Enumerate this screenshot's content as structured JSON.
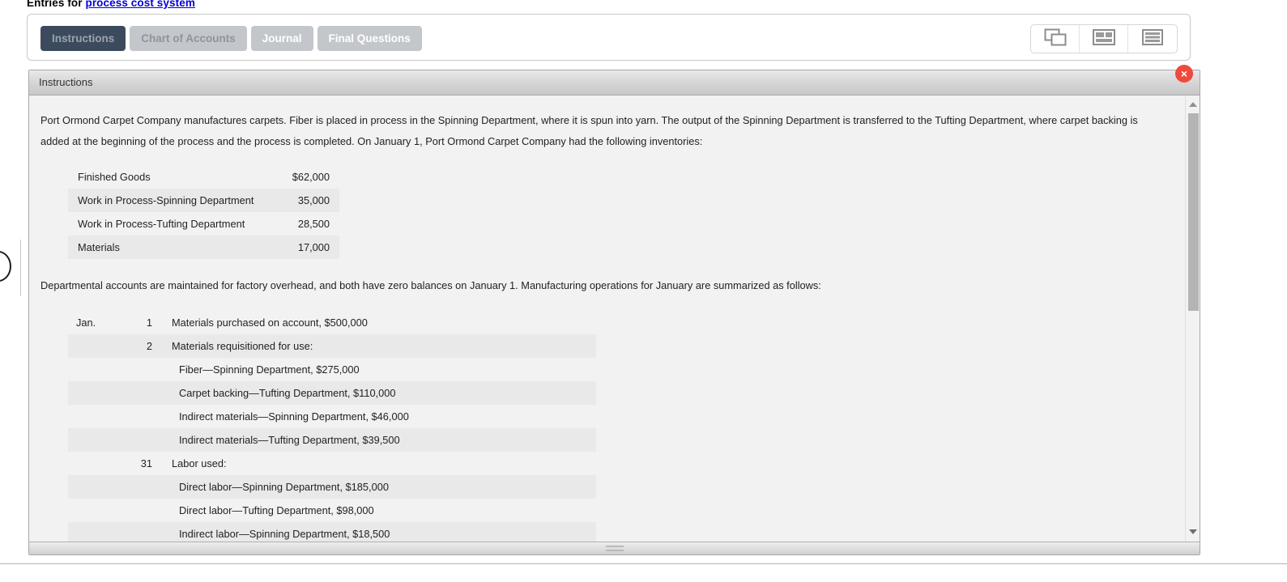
{
  "header": {
    "prefix": "Entries for ",
    "link_text": "process cost system"
  },
  "tabs": [
    {
      "label": "Instructions",
      "state": "active"
    },
    {
      "label": "Chart of Accounts",
      "state": "muted"
    },
    {
      "label": "Journal",
      "state": "plain"
    },
    {
      "label": "Final Questions",
      "state": "plain"
    }
  ],
  "view_toggles": [
    {
      "name": "cascade-windows-icon"
    },
    {
      "name": "split-view-icon"
    },
    {
      "name": "list-view-icon"
    }
  ],
  "panel": {
    "title": "Instructions",
    "close_label": "×",
    "paragraph_1": "Port Ormond Carpet Company manufactures carpets. Fiber is placed in process in the Spinning Department, where it is spun into yarn. The output of the Spinning Department is transferred to the Tufting Department, where carpet backing is added at the beginning of the process and the process is completed. On January 1, Port Ormond Carpet Company had the following inventories:",
    "paragraph_2": "Departmental accounts are maintained for factory overhead, and both have zero balances on January 1. Manufacturing operations for January are summarized as follows:"
  },
  "inventory_table": {
    "rows": [
      {
        "label": "Finished Goods",
        "amount": "$62,000"
      },
      {
        "label": "Work in Process-Spinning Department",
        "amount": "35,000"
      },
      {
        "label": "Work in Process-Tufting Department",
        "amount": "28,500"
      },
      {
        "label": "Materials",
        "amount": "17,000"
      }
    ]
  },
  "transactions_table": {
    "rows": [
      {
        "month": "Jan.",
        "day": "1",
        "description": "Materials purchased on account, $500,000",
        "indent": false
      },
      {
        "month": "",
        "day": "2",
        "description": "Materials requisitioned for use:",
        "indent": false
      },
      {
        "month": "",
        "day": "",
        "description": "Fiber—Spinning Department, $275,000",
        "indent": true
      },
      {
        "month": "",
        "day": "",
        "description": "Carpet backing—Tufting Department, $110,000",
        "indent": true
      },
      {
        "month": "",
        "day": "",
        "description": "Indirect materials—Spinning Department, $46,000",
        "indent": true
      },
      {
        "month": "",
        "day": "",
        "description": "Indirect materials—Tufting Department, $39,500",
        "indent": true
      },
      {
        "month": "",
        "day": "31",
        "description": "Labor used:",
        "indent": false
      },
      {
        "month": "",
        "day": "",
        "description": "Direct labor—Spinning Department, $185,000",
        "indent": true
      },
      {
        "month": "",
        "day": "",
        "description": "Direct labor—Tufting Department, $98,000",
        "indent": true
      },
      {
        "month": "",
        "day": "",
        "description": "Indirect labor—Spinning Department, $18,500",
        "indent": true
      }
    ]
  },
  "scrollbar": {
    "up_arrow": "scroll-up-arrow",
    "down_arrow": "scroll-down-arrow",
    "thumb": "scroll-thumb"
  },
  "colors": {
    "active_tab": "#3c4a5e",
    "inactive_tab": "#c3c7cc",
    "link": "#0000dd",
    "close_button": "#ef4a3c",
    "panel_bg": "#f2f2f2",
    "stripe": "#e9e9e9"
  }
}
